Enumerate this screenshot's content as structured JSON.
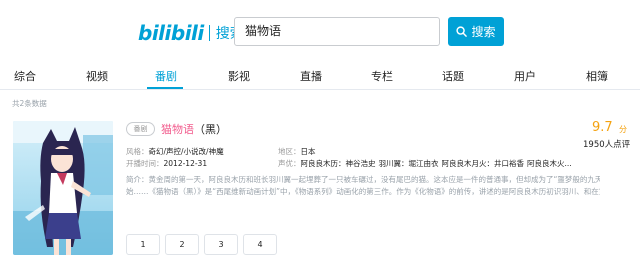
{
  "header": {
    "logo_text": "bilibili",
    "logo_sub": "搜索",
    "search_value": "猫物语",
    "search_button": "搜索"
  },
  "tabs": [
    {
      "label": "综合"
    },
    {
      "label": "视频"
    },
    {
      "label": "番剧"
    },
    {
      "label": "影视"
    },
    {
      "label": "直播"
    },
    {
      "label": "专栏"
    },
    {
      "label": "话题"
    },
    {
      "label": "用户"
    },
    {
      "label": "相簿"
    }
  ],
  "active_tab": "番剧",
  "result_count": "共2条数据",
  "result": {
    "badge": "番剧",
    "title_highlight": "猫物语",
    "title_rest": "（黑）",
    "style_label": "风格：",
    "style_value": "奇幻/声控/小说改/神魔",
    "region_label": "地区：",
    "region_value": "日本",
    "airdate_label": "开播时间：",
    "airdate_value": "2012-12-31",
    "cv_label": "声优：",
    "cv_items": [
      "阿良良木历：神谷浩史",
      "羽川翼：堀江由衣",
      "阿良良木月火：井口裕香",
      "阿良良木火..."
    ],
    "desc_line1": "简介：黄金周的第一天，阿良良木历和班长羽川翼一起埋葬了一只被车碾过，没有尾巴的猫。这本应是一件的普通事，但却成为了“噩梦般的九天”的开",
    "desc_line2": "始……《猫物语（黑）》是“西尾维新动画计划”中，《物语系列》动画化的第三作。作为《化物语》的前传，讲述的是阿良良木历初识羽川、和在黄...",
    "score": "9.7",
    "score_unit": "分",
    "reviews": "1950人点评",
    "episodes": [
      "1",
      "2",
      "3",
      "4"
    ]
  },
  "colors": {
    "accent": "#00a1d6",
    "highlight": "#f25d8e",
    "score": "#f4a210"
  }
}
